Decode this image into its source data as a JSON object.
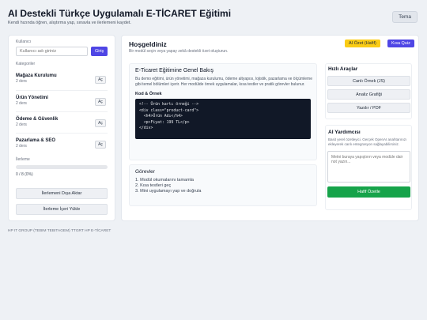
{
  "header": {
    "title": "AI Destekli Türkçe Uygulamalı E-TİCARET Eğitimi",
    "subtitle": "Kendi hızında öğren, alıştırma yap, sınavla ve ilerlemeni kaydet.",
    "theme_label": "Tema"
  },
  "sidebar": {
    "user_label": "Kullanıcı",
    "login_placeholder": "Kullanıcı adı giriniz",
    "login_button": "Giriş",
    "categories_label": "Kategoriler",
    "categories": [
      {
        "name": "Mağaza Kurulumu",
        "count": "2 ders",
        "open": "Aç"
      },
      {
        "name": "Ürün Yönetimi",
        "count": "2 ders",
        "open": "Aç"
      },
      {
        "name": "Ödeme & Güvenlik",
        "count": "2 ders",
        "open": "Aç"
      },
      {
        "name": "Pazarlama & SEO",
        "count": "2 ders",
        "open": "Aç"
      }
    ],
    "progress_label": "İlerleme",
    "progress_value": 0,
    "progress_text": "0 / 8 (0%)",
    "export_button": "İlerlemeni Dışa Aktar",
    "import_button": "İlerleme İçeri Yükle"
  },
  "main": {
    "welcome_title": "Hoşgeldiniz",
    "welcome_subtitle": "Bir modül seçin veya yapay zekâ destekli özet oluşturun.",
    "ai_summary_badge": "AI Özet (Hafif)",
    "quiz_button": "Kısa Quiz",
    "content": {
      "title": "E-Ticaret Eğitimine Genel Bakış",
      "description": "Bu demo eğitimi, ürün yönetimi, mağaza kurulumu, ödeme altyapısı, lojistik, pazarlama ve ölçümleme gibi temel bölümleri içerir. Her modülde örnek uygulamalar, kısa testler ve pratik görevler bulunur.",
      "code_heading": "Kod & Örnek",
      "code_lines": [
        "<!-- Ürün kartı örneği -->",
        "<div class=\"product-card\">",
        "  <h4>Ürün Adı</h4>",
        "  <p>Fiyat: 199 TL</p>",
        "</div>"
      ]
    },
    "tasks": {
      "title": "Görevler",
      "items": [
        "1. Modül okumalarını tamamla",
        "2. Kısa testleri geç",
        "3. Mini uygulamayı yap ve doğrula"
      ]
    },
    "tools": {
      "title": "Hızlı Araçlar",
      "buttons": [
        "Canlı Örnek (JS)",
        "Analiz Grafiği",
        "Yazdır / PDF"
      ]
    },
    "ai_assistant": {
      "title": "AI Yardımcısı",
      "description": "Basit yerel özetleyici. Gerçek OpenAI anahtarınızı ekleyerek canlı entegrasyon sağlayabilirsiniz.",
      "placeholder": "Metni buraya yapıştırın veya modüle dair not yazın...",
      "submit_label": "Hafif Özetle"
    }
  },
  "footer": {
    "text": "HP IT GROUP (TEBIM TEBITAGEM) TTGRT HP E-TİCARET"
  }
}
